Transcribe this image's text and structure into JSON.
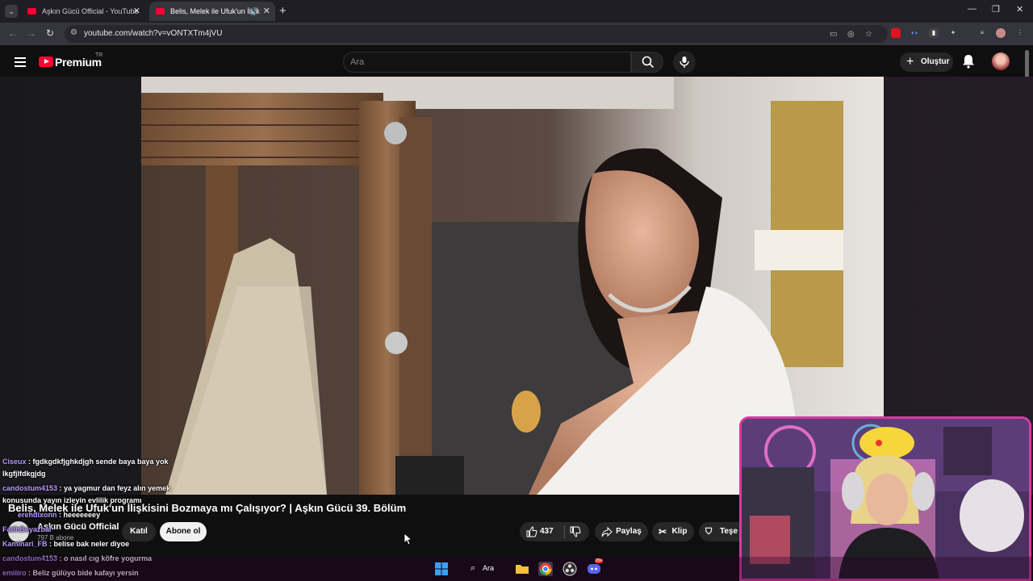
{
  "browser": {
    "tabs": [
      {
        "title": "Aşkın Gücü Official - YouTube",
        "active": false
      },
      {
        "title": "Belis, Melek ile Ufuk'un İlişk",
        "active": true
      }
    ],
    "url": "youtube.com/watch?v=vONTXTm4jVU"
  },
  "header": {
    "logo_text": "Premium",
    "region": "TR",
    "search_placeholder": "Ara",
    "create_label": "Oluştur"
  },
  "video": {
    "title": "Belis, Melek ile Ufuk'un İlişkisini Bozmaya mı Çalışıyor? | Aşkın Gücü 39. Bölüm",
    "channel": "Aşkın Gücü Official",
    "subscribers": "797 B abone",
    "join_label": "Katıl",
    "subscribe_label": "Abone ol",
    "likes": "437",
    "share_label": "Paylaş",
    "clip_label": "Klip",
    "thanks_label": "Teşe"
  },
  "chat": [
    {
      "user": "Ciseux",
      "text": ": fgdkgdkfjghkdjgh sende baya baya yok"
    },
    {
      "user": "",
      "text": "lkgfjlfdkgjdg"
    },
    {
      "user": "candostum4153",
      "text": ": ya yagmur dan feyz alın yemek"
    },
    {
      "user": "",
      "text": "konusunda yayın izleyin evlilik programı"
    },
    {
      "user": "erehdixonn",
      "text": ": heeeeeeey"
    },
    {
      "user": "FatihBeyazbal",
      "text": ""
    },
    {
      "user": "Kaminari_FB",
      "text": ": belise bak neler diyoe"
    },
    {
      "user": "candostum4153",
      "text": ": o nasıl cıg köfre yogurma"
    },
    {
      "user": "emiiiro",
      "text": ": Beliz gülüyo bide kafayı yersin"
    }
  ],
  "taskbar": {
    "search_label": "Ara",
    "discord_badge": "20+"
  },
  "colors": {
    "youtube_red": "#ff0033",
    "chat_username": "#b99bff",
    "webcam_border": "#d63b9e"
  }
}
